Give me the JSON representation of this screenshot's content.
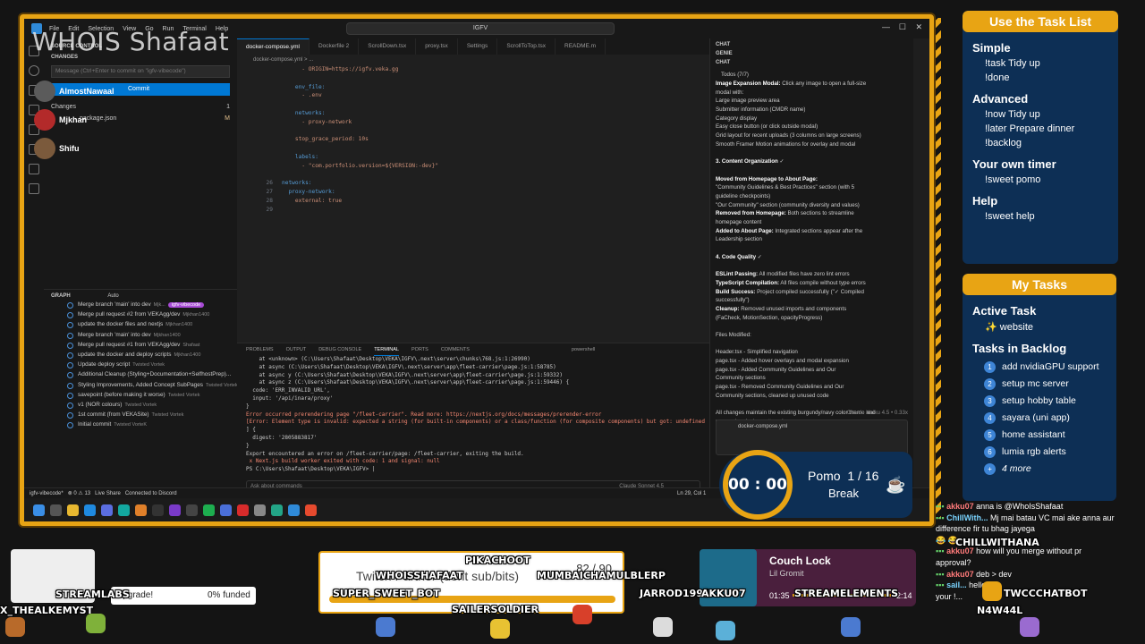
{
  "overlay": {
    "whois": "WHOIS Shafaat",
    "viewers": [
      {
        "name": "AlmostNawaal",
        "color": "#5b5b5b"
      },
      {
        "name": "Mjkhan",
        "color": "#b32a2a"
      },
      {
        "name": "Shifu",
        "color": "#7b5a3c"
      }
    ]
  },
  "vscode": {
    "menu": [
      "File",
      "Edit",
      "Selection",
      "View",
      "Go",
      "Run",
      "Terminal",
      "Help"
    ],
    "search": "IGFV",
    "source_control": {
      "header": "SOURCE CONTROL",
      "changes_label": "CHANGES",
      "message_placeholder": "Message (Ctrl+Enter to commit on \"igfv-vibecode\")",
      "commit_label": "Commit",
      "changes_group": "Changes",
      "changes_count": "1",
      "changed_file": "package.json",
      "changed_status": "M"
    },
    "graph": {
      "header": "GRAPH",
      "auto": "Auto",
      "branch_badge": "igfv-vibecode",
      "commits": [
        {
          "msg": "Merge branch 'main' into dev",
          "author": "Mjk..."
        },
        {
          "msg": "Merge pull request #2 from VEKAgg/dev",
          "author": "Mjkhan1400"
        },
        {
          "msg": "update the docker files and nextjs",
          "author": "Mjkhan1400"
        },
        {
          "msg": "Merge branch 'main' into dev",
          "author": "Mjkhan1400"
        },
        {
          "msg": "Merge pull request #1 from VEKAgg/dev",
          "author": "Shafaat"
        },
        {
          "msg": "update the docker and deploy scripts",
          "author": "Mjkhan1400"
        },
        {
          "msg": "Update deploy script",
          "author": "Twisted Vortek"
        },
        {
          "msg": "Additional Cleanup (Styling+Documentation+SelfhostPrep)...",
          "author": ""
        },
        {
          "msg": "Styling Improvements, Added Concept SubPages",
          "author": "Twisted Vortek"
        },
        {
          "msg": "savepoint (before making it worse)",
          "author": "Twisted Vortek"
        },
        {
          "msg": "v1 (NOR colours)",
          "author": "Twisted Vortek"
        },
        {
          "msg": "1st commit (from VEKASite)",
          "author": "Twisted Vortek"
        },
        {
          "msg": "Initial commit",
          "author": "Twisted VorteK"
        }
      ]
    },
    "tabs": [
      "docker-compose.yml",
      "Dockerfile 2",
      "ScrollDown.tsx",
      "proxy.tsx",
      "Settings",
      "ScrollToTop.tsx",
      "README.m"
    ],
    "breadcrumb": "docker-compose.yml > ...",
    "code": [
      {
        "n": "",
        "text": "      - ORIGIN=https://igfv.veka.gg"
      },
      {
        "n": "",
        "text": ""
      },
      {
        "n": "",
        "text": "    env_file:"
      },
      {
        "n": "",
        "text": "      - .env"
      },
      {
        "n": "",
        "text": ""
      },
      {
        "n": "",
        "text": "    networks:"
      },
      {
        "n": "",
        "text": "      - proxy-network"
      },
      {
        "n": "",
        "text": ""
      },
      {
        "n": "",
        "text": "    stop_grace_period: 10s"
      },
      {
        "n": "",
        "text": ""
      },
      {
        "n": "",
        "text": "    labels:"
      },
      {
        "n": "",
        "text": "      - \"com.portfolio.version=${VERSION:-dev}\""
      },
      {
        "n": "",
        "text": ""
      },
      {
        "n": "26",
        "text": "networks:"
      },
      {
        "n": "27",
        "text": "  proxy-network:"
      },
      {
        "n": "28",
        "text": "    external: true"
      },
      {
        "n": "29",
        "text": ""
      }
    ],
    "terminal_tabs": [
      "PROBLEMS",
      "OUTPUT",
      "DEBUG CONSOLE",
      "TERMINAL",
      "PORTS",
      "COMMENTS"
    ],
    "terminal_shell": "powershell",
    "terminal": [
      "    at <unknown> (C:\\Users\\Shafaat\\Desktop\\VEKA\\IGFV\\.next\\server\\chunks\\768.js:1:26990)",
      "    at async (C:\\Users\\Shafaat\\Desktop\\VEKA\\IGFV\\.next\\server\\app\\fleet-carrier\\page.js:1:58785)",
      "    at async y (C:\\Users\\Shafaat\\Desktop\\VEKA\\IGFV\\.next\\server\\app\\fleet-carrier\\page.js:1:59332)",
      "    at async z (C:\\Users\\Shafaat\\Desktop\\VEKA\\IGFV\\.next\\server\\app\\fleet-carrier\\page.js:1:59446) {",
      "  code: 'ERR_INVALID_URL',",
      "  input: '/api/inara/proxy'",
      "}",
      "Error occurred prerendering page \"/fleet-carrier\". Read more: https://nextjs.org/docs/messages/prerender-error",
      "[Error: Element type is invalid: expected a string (for built-in components) or a class/function (for composite components) but got: undefined",
      "] {",
      "  digest: '2805883817'",
      "}",
      "Export encountered an error on /fleet-carrier/page: /fleet-carrier, exiting the build.",
      " x Next.js build worker exited with code: 1 and signal: null",
      "PS C:\\Users\\Shafaat\\Desktop\\VEKA\\IGFV> |"
    ],
    "ask_placeholder": "Ask about commands",
    "ask_model": "Claude Sonnet 4.5",
    "chat": {
      "title": "CHAT",
      "session": "GENIE",
      "sub": "CHAT",
      "todos": "Todos (7/7)",
      "lines": [
        {
          "b": "Image Expansion Modal:",
          "t": " Click any image to open a full-size"
        },
        {
          "b": "",
          "t": "   modal with:"
        },
        {
          "b": "",
          "t": "      Large image preview area"
        },
        {
          "b": "",
          "t": "      Submitter information (CMDR name)"
        },
        {
          "b": "",
          "t": "      Category display"
        },
        {
          "b": "",
          "t": "      Easy close button (or click outside modal)"
        },
        {
          "b": "",
          "t": " Grid layout for recent uploads (3 columns on large screens)"
        },
        {
          "b": "",
          "t": " Smooth Framer Motion animations for overlay and modal"
        },
        {
          "b": "",
          "t": ""
        },
        {
          "b": "3. Content Organization",
          "t": " ✓"
        },
        {
          "b": "",
          "t": ""
        },
        {
          "b": "Moved from Homepage to About Page:",
          "t": ""
        },
        {
          "b": "",
          "t": "   \"Community Guidelines & Best Practices\" section (with 5"
        },
        {
          "b": "",
          "t": "   guideline checkpoints)"
        },
        {
          "b": "",
          "t": "   \"Our Community\" section (community diversity and values)"
        },
        {
          "b": "Removed from Homepage:",
          "t": " Both sections to streamline"
        },
        {
          "b": "",
          "t": "   homepage content"
        },
        {
          "b": "Added to About Page:",
          "t": " Integrated sections appear after the"
        },
        {
          "b": "",
          "t": "   Leadership section"
        },
        {
          "b": "",
          "t": ""
        },
        {
          "b": "4. Code Quality",
          "t": " ✓"
        },
        {
          "b": "",
          "t": ""
        },
        {
          "b": "ESLint Passing:",
          "t": " All modified files have zero lint errors"
        },
        {
          "b": "TypeScript Compilation:",
          "t": " All files compile without type errors"
        },
        {
          "b": "Build Success:",
          "t": " Project compiled successfully (\"✓ Compiled"
        },
        {
          "b": "",
          "t": "   successfully\")"
        },
        {
          "b": "Cleanup:",
          "t": " Removed unused imports and components"
        },
        {
          "b": "",
          "t": "   (FaCheck, MotionSection, opacityProgress)"
        },
        {
          "b": "",
          "t": ""
        },
        {
          "b": "",
          "t": "Files Modified:"
        },
        {
          "b": "",
          "t": ""
        },
        {
          "b": "",
          "t": "   Header.tsx  - Simplified navigation"
        },
        {
          "b": "",
          "t": "   page.tsx  - Added hover overlays and modal expansion"
        },
        {
          "b": "",
          "t": "   page.tsx  - Added Community Guidelines and Our"
        },
        {
          "b": "",
          "t": "   Community sections"
        },
        {
          "b": "",
          "t": "   page.tsx  - Removed Community Guidelines and Our"
        },
        {
          "b": "",
          "t": "   Community sections, cleaned up unused code"
        },
        {
          "b": "",
          "t": ""
        },
        {
          "b": "",
          "t": "All changes maintain the existing burgundy/navy color theme and"
        },
        {
          "b": "",
          "t": "responsive design patterns!"
        }
      ],
      "model_footer": "Claude Haiku 4.5 • 0.33x",
      "attachment": "docker-compose.yml"
    },
    "status": {
      "branch": "igfv-vibecode*",
      "errors": "⊗ 0 ⚠ 13",
      "liveshare": "Live Share",
      "discord": "Connected to Discord",
      "position": "Ln 29, Col 1"
    }
  },
  "pomodoro": {
    "time": "00 : 00",
    "label": "Pomo",
    "count": "1 / 16",
    "state": "Break"
  },
  "commands_panel": {
    "title": "Use the Task List",
    "sections": [
      {
        "h": "Simple",
        "items": [
          "!task Tidy up",
          "!done"
        ]
      },
      {
        "h": "Advanced",
        "items": [
          "!now Tidy up",
          "!later Prepare dinner",
          "!backlog"
        ]
      },
      {
        "h": "Your own timer",
        "items": [
          "!sweet pomo"
        ]
      },
      {
        "h": "Help",
        "items": [
          "!sweet help"
        ]
      }
    ]
  },
  "tasks_panel": {
    "title": "My Tasks",
    "active_label": "Active Task",
    "active_task": "✨ website",
    "backlog_label": "Tasks in Backlog",
    "backlog": [
      "add nvidiaGPU support",
      "setup mc server",
      "setup hobby table",
      "sayara (uni app)",
      "home assistant",
      "lumia rgb alerts"
    ],
    "more": "4 more"
  },
  "widgets": {
    "goal_title": "Twitch Partner (dont sub/bits)",
    "goal_progress": "82 / 90",
    "upgrade_text": "Upgrade!",
    "funded_text": "0% funded",
    "song_title": "Couch Lock",
    "song_artist": "Lil Gromit",
    "song_time": "01:35",
    "song_end": "2:14"
  },
  "bots": [
    "STREAMLABS",
    "X_THEALKEMYST",
    "WHOISSHAFAAT",
    "SUPER_SWEET_BOT",
    "PIKACHOOT",
    "MUMBAICHAMULBLERP",
    "JARROD1991",
    "AKKU07",
    "STREAMELEMENTS",
    "SAILERSOLDIER",
    "CHILLWITHANA",
    "TWCCCHATBOT",
    "N4W44L"
  ],
  "chat_feed": [
    {
      "u": "akku07",
      "m": "anna is @WhoIsShafaat"
    },
    {
      "u": "ChillWith...",
      "m": "Mj mai batau VC mai ake anna aur"
    },
    {
      "u": "",
      "m": "difference fir tu bhag jayega"
    },
    {
      "u": "",
      "m": "😂 😂"
    },
    {
      "u": "akku07",
      "m": "how will you merge without pr"
    },
    {
      "u": "",
      "m": "approval?"
    },
    {
      "u": "akku07",
      "m": "deb > dev"
    },
    {
      "u": "sail...",
      "m": "hello"
    },
    {
      "u": "",
      "m": "your !..."
    }
  ],
  "colors": {
    "accent": "#e8a414",
    "panel": "#0d2f55",
    "vscode_blue": "#0078d4"
  }
}
